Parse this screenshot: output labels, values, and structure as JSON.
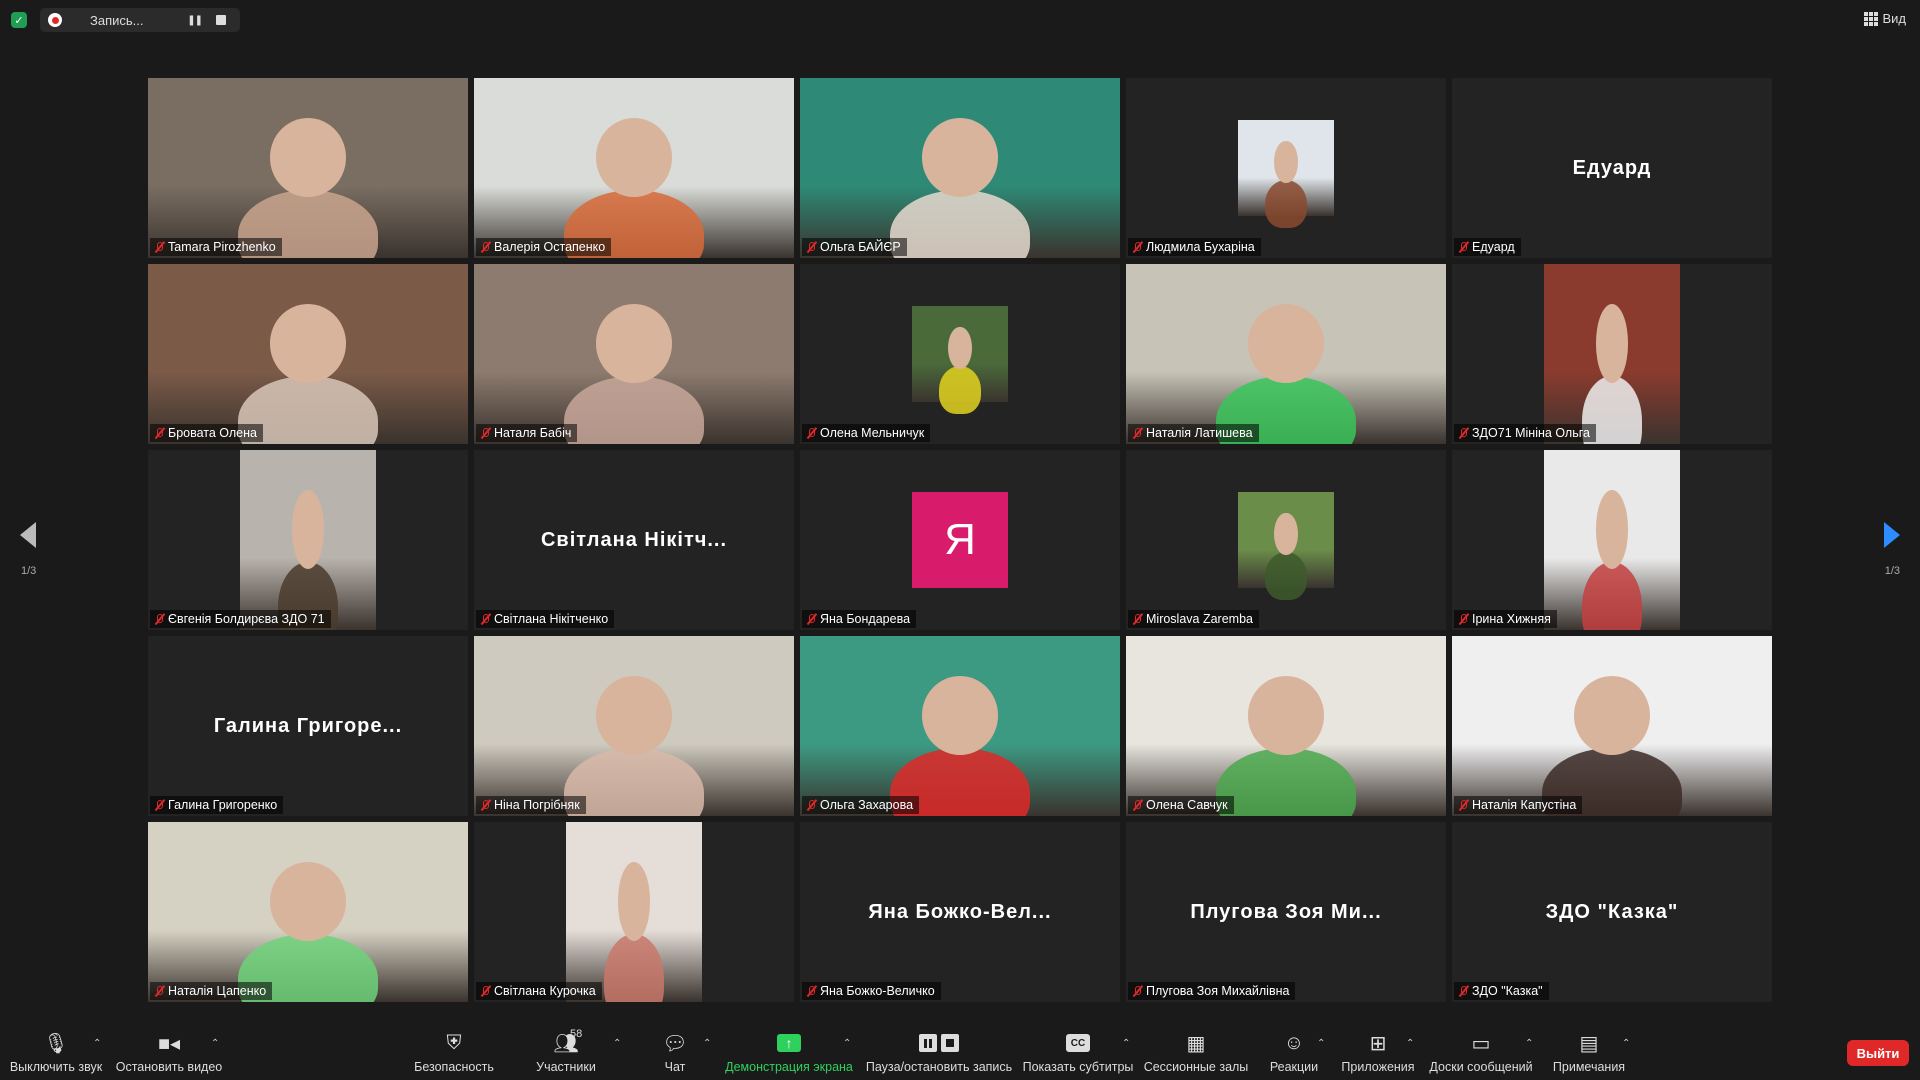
{
  "topbar": {
    "recording_label": "Запись...",
    "view_label": "Вид"
  },
  "pager": {
    "left_page": "1/3",
    "right_page": "1/3"
  },
  "participants": [
    {
      "name": "Tamara Pirozhenko",
      "display": "video",
      "bg": "#7a6e62",
      "fg": "#c9a58e"
    },
    {
      "name": "Валерія Остапенко",
      "display": "video",
      "bg": "#d9dcd8",
      "fg": "#d86a3a",
      "active": true
    },
    {
      "name": "Ольга БАЙЄР",
      "display": "video",
      "bg": "#2e8a76",
      "fg": "#e7d9cf"
    },
    {
      "name": "Людмила Бухаріна",
      "display": "small",
      "bg": "#dfe5ea",
      "fg": "#8a4a2f"
    },
    {
      "name": "Едуард",
      "display": "text",
      "big": "Едуард"
    },
    {
      "name": "Бровата Олена",
      "display": "video",
      "bg": "#7b5a48",
      "fg": "#d8c7b8"
    },
    {
      "name": "Наталя Бабіч",
      "display": "video",
      "bg": "#8c7b6e",
      "fg": "#c8a79a"
    },
    {
      "name": "Олена Мельничук",
      "display": "small",
      "bg": "#4a6a3a",
      "fg": "#e3d21e"
    },
    {
      "name": "Наталія Латишева",
      "display": "video",
      "bg": "#c7c3b7",
      "fg": "#39c45a"
    },
    {
      "name": "ЗДО71 Мініна Ольга",
      "display": "portrait",
      "bg": "#8a3b2e",
      "fg": "#eeeeee"
    },
    {
      "name": "Євгенія Болдирєва ЗДО 71",
      "display": "portrait",
      "bg": "#b9b3ad",
      "fg": "#4a3b2b"
    },
    {
      "name": "Світлана Нікітченко",
      "display": "text",
      "big": "Світлана Нікітч..."
    },
    {
      "name": "Яна Бондарева",
      "display": "letter",
      "letter": "Я",
      "color": "#d81c6b"
    },
    {
      "name": "Miroslava Zaremba",
      "display": "small",
      "bg": "#6b8d4a",
      "fg": "#3d5a2b"
    },
    {
      "name": "Ірина Хижняя",
      "display": "portrait",
      "bg": "#e9e9e9",
      "fg": "#c44040"
    },
    {
      "name": "Галина Григоренко",
      "display": "text",
      "big": "Галина Григоре..."
    },
    {
      "name": "Ніна Погрібняк",
      "display": "video",
      "bg": "#cfcabf",
      "fg": "#d8b9a8"
    },
    {
      "name": "Ольга Захарова",
      "display": "video",
      "bg": "#3c9a82",
      "fg": "#e02828"
    },
    {
      "name": "Олена Савчук",
      "display": "video",
      "bg": "#e8e5df",
      "fg": "#4ba84c"
    },
    {
      "name": "Наталія Капустіна",
      "display": "video",
      "bg": "#efeff0",
      "fg": "#3b2a26"
    },
    {
      "name": "Наталія Цапенко",
      "display": "video",
      "bg": "#d6d2c3",
      "fg": "#6fd27a"
    },
    {
      "name": "Світлана Курочка",
      "display": "portrait",
      "bg": "#e4ddd8",
      "fg": "#c8786a"
    },
    {
      "name": "Яна Божко-Величко",
      "display": "text",
      "big": "Яна Божко-Вел..."
    },
    {
      "name": "Плугова Зоя Михайлівна",
      "display": "text",
      "big": "Плугова Зоя Ми..."
    },
    {
      "name": "ЗДО \"Казка\"",
      "display": "text",
      "big": "ЗДО \"Казка\""
    }
  ],
  "toolbar": {
    "mute_label": "Выключить звук",
    "video_label": "Остановить видео",
    "security_label": "Безопасность",
    "participants_label": "Участники",
    "participants_count": "58",
    "chat_label": "Чат",
    "share_label": "Демонстрация экрана",
    "record_label": "Пауза/остановить запись",
    "cc_label": "Показать субтитры",
    "cc_icon_text": "CC",
    "breakout_label": "Сессионные залы",
    "reactions_label": "Реакции",
    "apps_label": "Приложения",
    "whiteboard_label": "Доски сообщений",
    "notes_label": "Примечания",
    "leave_label": "Выйти"
  }
}
